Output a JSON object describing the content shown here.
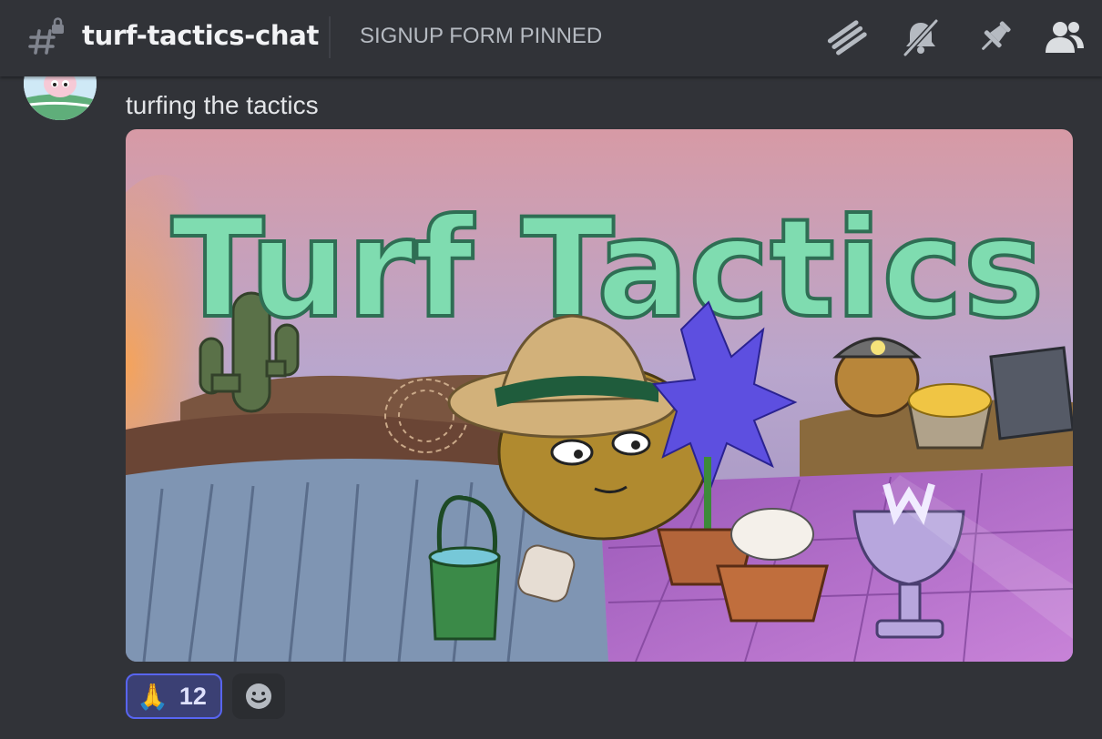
{
  "header": {
    "channel_icon": "hash-lock-icon",
    "channel_name": "turf-tactics-chat",
    "topic": "SIGNUP FORM PINNED",
    "actions": [
      {
        "name": "threads-icon"
      },
      {
        "name": "notifications-muted-icon"
      },
      {
        "name": "pinned-messages-icon"
      },
      {
        "name": "member-list-icon"
      }
    ]
  },
  "message": {
    "text": "turfing the tactics",
    "attachment": {
      "title_art_text": "Turf Tactics"
    },
    "reactions": [
      {
        "emoji": "🙏",
        "count": "12",
        "active": true
      }
    ],
    "add_reaction_icon": "smiley-icon"
  },
  "colors": {
    "background": "#313338",
    "reaction_active_bg": "#3b4074",
    "reaction_border": "#5865f2"
  }
}
